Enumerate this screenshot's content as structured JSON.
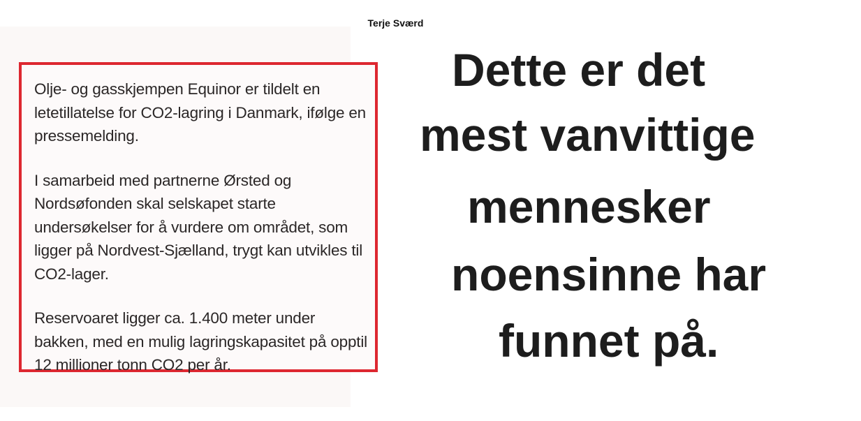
{
  "author": "Terje Sværd",
  "quote": {
    "paragraphs": [
      "Olje- og gasskjempen Equinor er tildelt en letetillatelse for CO2-lagring i Danmark, ifølge en pressemelding.",
      "I samarbeid med partnerne Ørsted og Nordsøfonden skal selskapet starte undersøkelser for å vurdere om området, som ligger på Nordvest-Sjælland, trygt kan utvikles til CO2-lager.",
      "Reservoaret ligger ca. 1.400 meter under bakken, med en mulig lagringskapasitet på opptil 12 millioner tonn CO2 per år."
    ],
    "border_color": "#dd2730"
  },
  "headline": {
    "lines": [
      "Dette er det",
      "mest vanvittige",
      "mennesker",
      "noensinne har",
      "funnet på."
    ]
  }
}
